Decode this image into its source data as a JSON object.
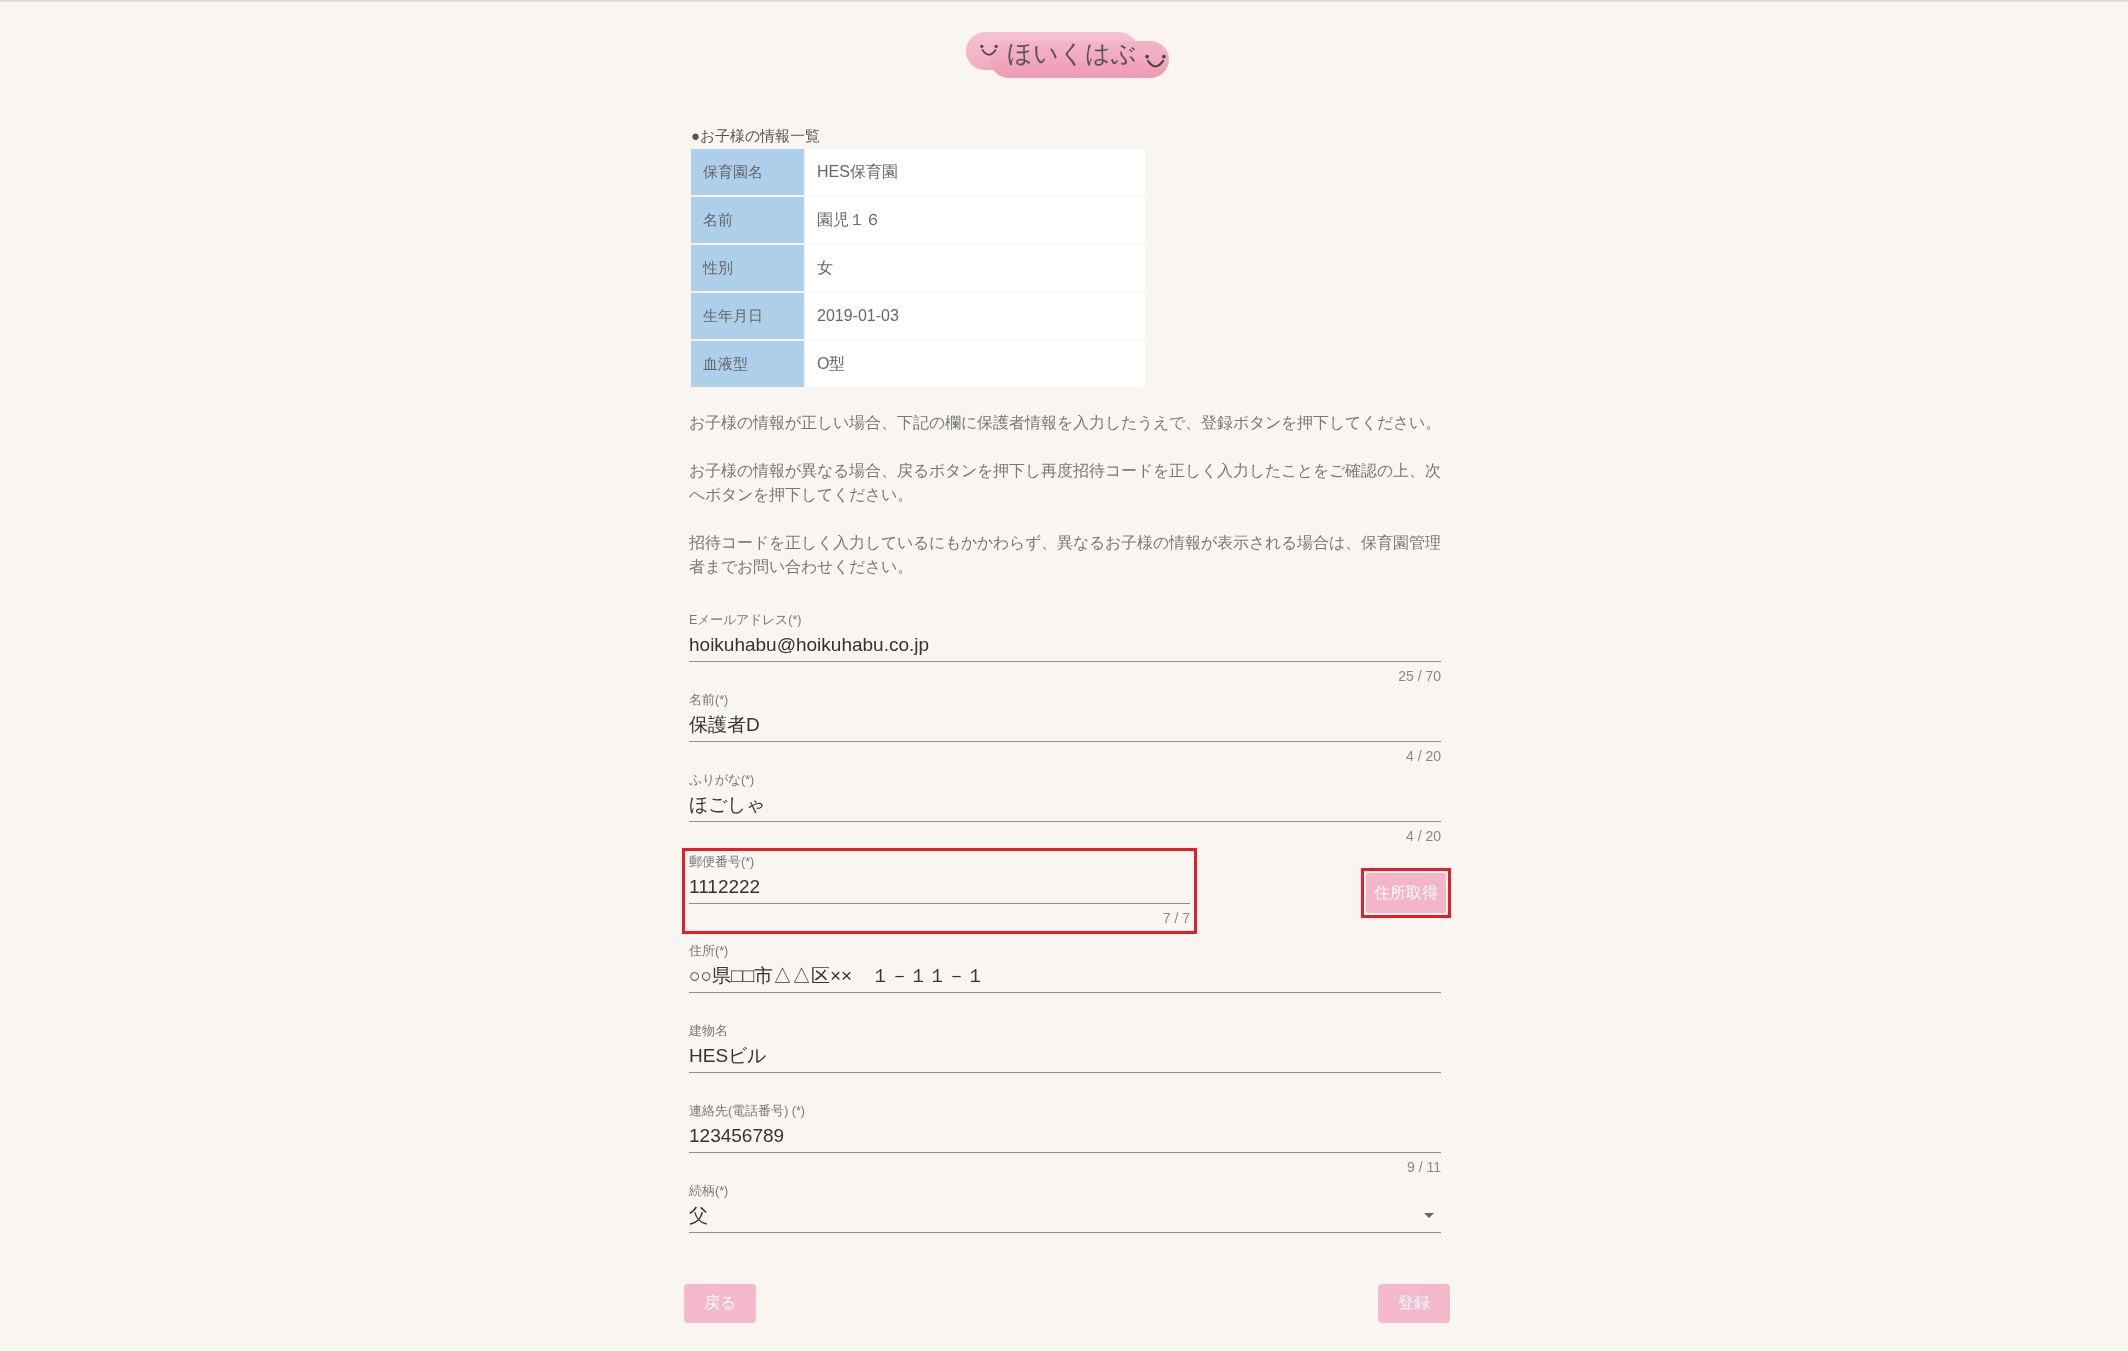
{
  "logo": {
    "text": "ほいくはぶ"
  },
  "child_info": {
    "title": "●お子様の情報一覧",
    "rows": [
      {
        "label": "保育園名",
        "value": "HES保育園"
      },
      {
        "label": "名前",
        "value": "園児１６"
      },
      {
        "label": "性別",
        "value": "女"
      },
      {
        "label": "生年月日",
        "value": "2019-01-03"
      },
      {
        "label": "血液型",
        "value": "O型"
      }
    ]
  },
  "notes": [
    "お子様の情報が正しい場合、下記の欄に保護者情報を入力したうえで、登録ボタンを押下してください。",
    "お子様の情報が異なる場合、戻るボタンを押下し再度招待コードを正しく入力したことをご確認の上、次へボタンを押下してください。",
    "招待コードを正しく入力しているにもかかわらず、異なるお子様の情報が表示される場合は、保育園管理者までお問い合わせください。"
  ],
  "form": {
    "fields": [
      {
        "kind": "text",
        "label": "Eメールアドレス(*)",
        "value": "hoikuhabu@hoikuhabu.co.jp",
        "counter": "25 / 70",
        "highlighted": false
      },
      {
        "kind": "text",
        "label": "名前(*)",
        "value": "保護者D",
        "counter": "4 / 20",
        "highlighted": false
      },
      {
        "kind": "text",
        "label": "ふりがな(*)",
        "value": "ほごしゃ",
        "counter": "4 / 20",
        "highlighted": false
      },
      {
        "kind": "postal",
        "label": "郵便番号(*)",
        "value": "1112222",
        "counter": "7 / 7",
        "highlighted": true,
        "action": {
          "label": "住所取得",
          "highlighted": true
        }
      },
      {
        "kind": "text",
        "label": "住所(*)",
        "value": "○○県□□市△△区××　１－１１－１",
        "highlighted": false
      },
      {
        "kind": "text",
        "label": "建物名",
        "value": "HESビル",
        "highlighted": false
      },
      {
        "kind": "text",
        "label": "連絡先(電話番号) (*)",
        "value": "123456789",
        "counter": "9 / 11",
        "highlighted": false
      },
      {
        "kind": "select",
        "label": "続柄(*)",
        "value": "父",
        "highlighted": false
      }
    ]
  },
  "buttons": [
    {
      "kind": "back",
      "label": "戻る"
    },
    {
      "kind": "submit",
      "label": "登録"
    }
  ]
}
